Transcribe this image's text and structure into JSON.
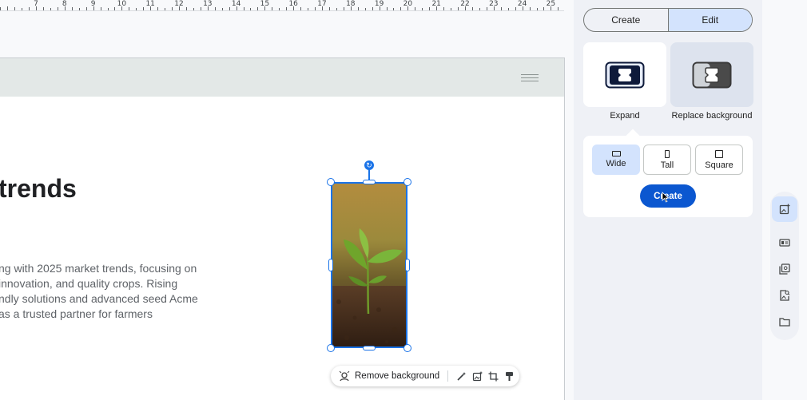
{
  "ruler": {
    "numbers": [
      "7",
      "8",
      "9",
      "10",
      "11",
      "12",
      "13",
      "14",
      "15",
      "16",
      "17",
      "18",
      "19",
      "20",
      "21",
      "22",
      "23",
      "24",
      "25"
    ]
  },
  "document": {
    "heading": "trends",
    "paragraph": "ng with 2025 market trends, focusing on innovation, and quality crops. Rising ndly solutions and advanced seed Acme as a trusted partner for farmers"
  },
  "image_toolbar": {
    "remove_background_label": "Remove background",
    "tools": [
      "magic-edit-icon",
      "generate-image-icon",
      "crop-icon",
      "format-painter-icon"
    ]
  },
  "panel": {
    "tabs": [
      {
        "label": "Create",
        "active": false
      },
      {
        "label": "Edit",
        "active": true
      }
    ],
    "options": [
      {
        "label": "Expand",
        "icon": "expand-icon"
      },
      {
        "label": "Replace background",
        "icon": "replace-background-icon"
      }
    ],
    "sizes": [
      {
        "label": "Wide",
        "active": true
      },
      {
        "label": "Tall",
        "active": false
      },
      {
        "label": "Square",
        "active": false
      }
    ],
    "create_label": "Create"
  },
  "rail": {
    "items": [
      "add-image-icon",
      "layout-icon",
      "gallery-icon",
      "image-search-icon",
      "folder-icon"
    ]
  },
  "colors": {
    "accent": "#0b57d0",
    "selection": "#1a73e8",
    "active_tab": "#d3e3fd",
    "header_band": "#e3e8e7"
  }
}
